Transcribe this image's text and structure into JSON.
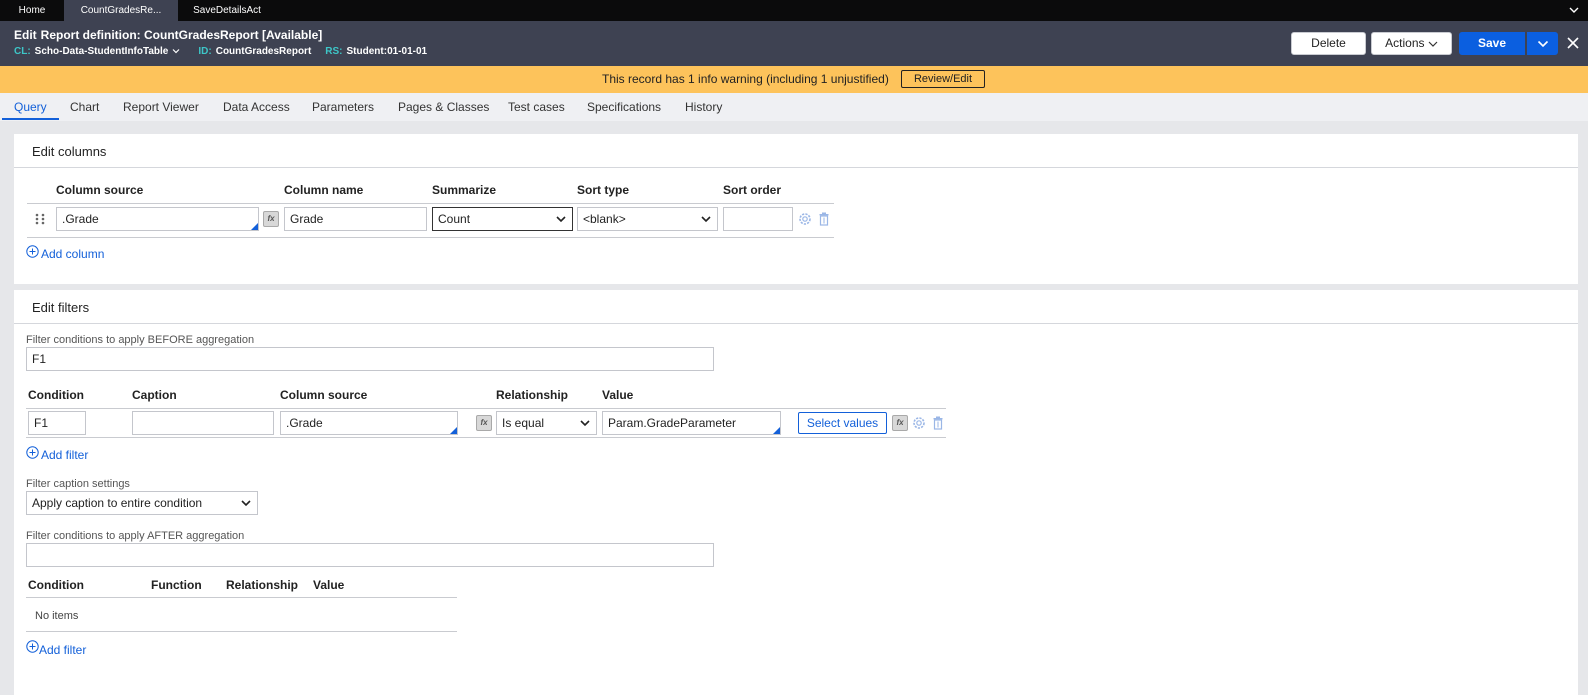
{
  "tabs": [
    {
      "label": "Home"
    },
    {
      "label": "CountGradesRe..."
    },
    {
      "label": "SaveDetailsAct"
    }
  ],
  "header": {
    "edit_label": "Edit",
    "title": "Report definition: CountGradesReport [Available]",
    "cl_key": "CL:",
    "cl_value": "Scho-Data-StudentInfoTable",
    "id_key": "ID:",
    "id_value": "CountGradesReport",
    "rs_key": "RS:",
    "rs_value": "Student:01-01-01",
    "delete_label": "Delete",
    "actions_label": "Actions",
    "save_label": "Save"
  },
  "warning": {
    "message": "This record has 1 info warning (including 1 unjustified)",
    "review_label": "Review/Edit"
  },
  "rule_tabs": [
    {
      "label": "Query"
    },
    {
      "label": "Chart"
    },
    {
      "label": "Report Viewer"
    },
    {
      "label": "Data Access"
    },
    {
      "label": "Parameters"
    },
    {
      "label": "Pages & Classes"
    },
    {
      "label": "Test cases"
    },
    {
      "label": "Specifications"
    },
    {
      "label": "History"
    }
  ],
  "edit_columns": {
    "heading": "Edit columns",
    "headers": {
      "column_source": "Column source",
      "column_name": "Column name",
      "summarize": "Summarize",
      "sort_type": "Sort type",
      "sort_order": "Sort order"
    },
    "row": {
      "column_source": ".Grade",
      "column_name": "Grade",
      "summarize": "Count",
      "sort_type": "<blank>",
      "sort_order": ""
    },
    "add_column_label": "Add column"
  },
  "edit_filters": {
    "heading": "Edit filters",
    "before_label": "Filter conditions to apply BEFORE aggregation",
    "before_value": "F1",
    "headers": {
      "condition": "Condition",
      "caption": "Caption",
      "column_source": "Column source",
      "relationship": "Relationship",
      "value": "Value"
    },
    "row": {
      "condition": "F1",
      "caption": "",
      "column_source": ".Grade",
      "relationship": "Is equal",
      "value": "Param.GradeParameter",
      "select_values_label": "Select values"
    },
    "add_filter_label": "Add filter",
    "caption_settings_label": "Filter caption settings",
    "caption_settings_value": "Apply caption to entire condition",
    "after_label": "Filter conditions to apply AFTER aggregation",
    "after_value": "",
    "after_headers": {
      "condition": "Condition",
      "function": "Function",
      "relationship": "Relationship",
      "value": "Value"
    },
    "no_items": "No items",
    "add_filter_label_2": "Add filter"
  },
  "icons": {
    "fx": "fx",
    "gear": "gear-icon",
    "trash": "trash-icon",
    "drag": "drag-handle-icon",
    "plus": "add-circle-icon",
    "chevron": "chevron-down-icon",
    "close": "close-icon"
  },
  "colors": {
    "header_bg": "#3e4252",
    "tabstrip_bg": "#0b0b0c",
    "accent_teal": "#3dc6c8",
    "warning_bg": "#fdc35b",
    "primary": "#0b5fe0",
    "link": "#1360d9"
  }
}
